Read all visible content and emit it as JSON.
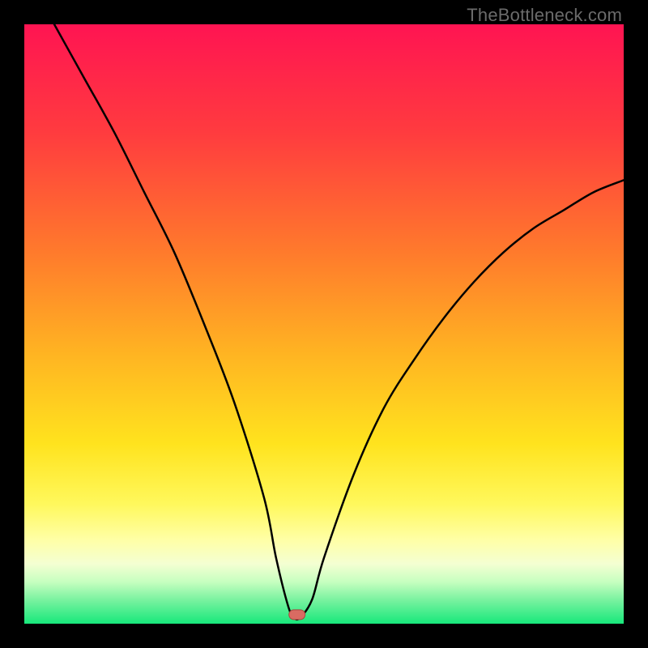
{
  "watermark": "TheBottleneck.com",
  "chart_data": {
    "type": "line",
    "title": "",
    "xlabel": "",
    "ylabel": "",
    "xlim": [
      0,
      100
    ],
    "ylim": [
      0,
      100
    ],
    "series": [
      {
        "name": "bottleneck-curve",
        "x": [
          5,
          10,
          15,
          20,
          25,
          30,
          35,
          40,
          42,
          44,
          45,
          46,
          48,
          50,
          55,
          60,
          65,
          70,
          75,
          80,
          85,
          90,
          95,
          100
        ],
        "y": [
          100,
          91,
          82,
          72,
          62,
          50,
          37,
          21,
          11,
          3,
          1,
          1,
          4,
          11,
          25,
          36,
          44,
          51,
          57,
          62,
          66,
          69,
          72,
          74
        ]
      }
    ],
    "marker": {
      "x": 45.5,
      "y": 1.5
    },
    "gradient_stops": [
      {
        "offset": 0.0,
        "color": "#ff1452"
      },
      {
        "offset": 0.18,
        "color": "#ff3b3f"
      },
      {
        "offset": 0.38,
        "color": "#ff7a2c"
      },
      {
        "offset": 0.55,
        "color": "#ffb422"
      },
      {
        "offset": 0.7,
        "color": "#ffe31e"
      },
      {
        "offset": 0.8,
        "color": "#fff85c"
      },
      {
        "offset": 0.86,
        "color": "#ffffa6"
      },
      {
        "offset": 0.9,
        "color": "#f4ffd2"
      },
      {
        "offset": 0.93,
        "color": "#c7ffc0"
      },
      {
        "offset": 0.96,
        "color": "#7af2a0"
      },
      {
        "offset": 1.0,
        "color": "#17e87b"
      }
    ],
    "marker_color": "#d96b62",
    "marker_stroke": "#a8463e",
    "curve_color": "#000000"
  }
}
